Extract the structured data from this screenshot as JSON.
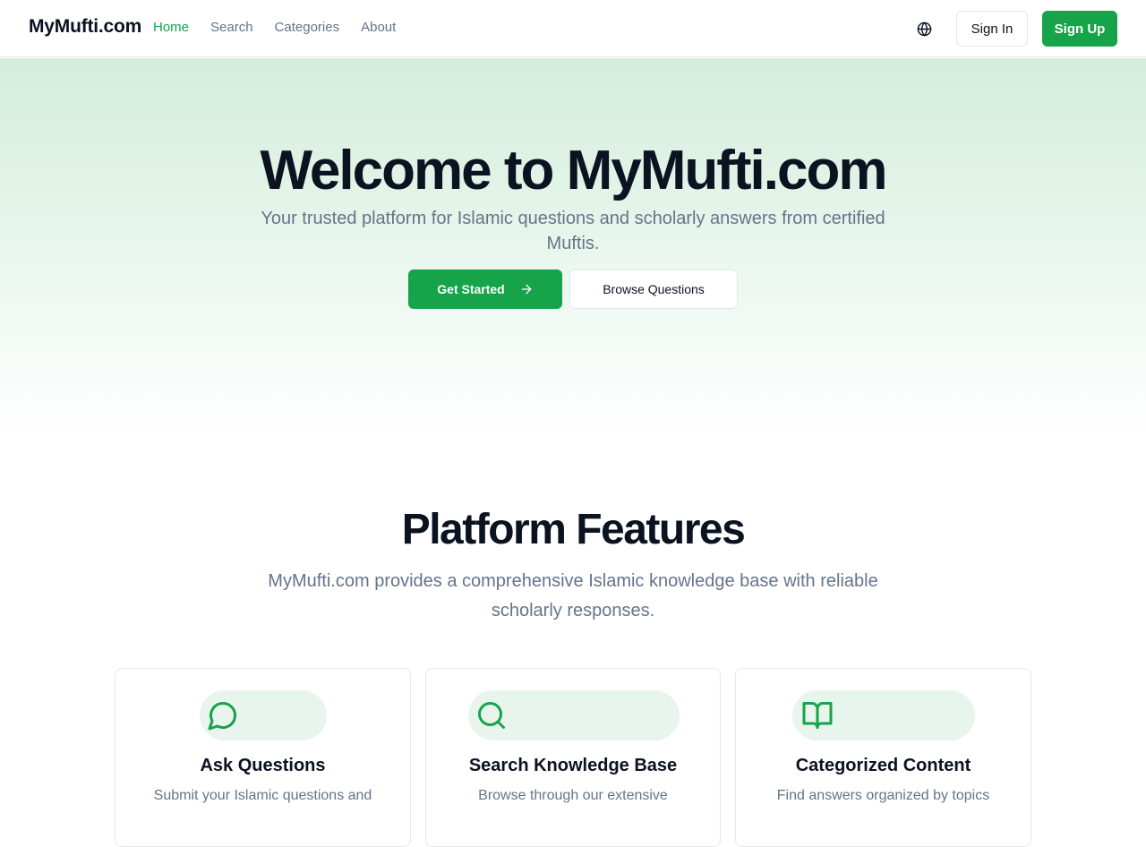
{
  "header": {
    "logo": "MyMufti.com",
    "nav": [
      {
        "label": "Home"
      },
      {
        "label": "Search"
      },
      {
        "label": "Categories"
      },
      {
        "label": "About"
      }
    ],
    "sign_in": "Sign In",
    "sign_up": "Sign Up"
  },
  "hero": {
    "title": "Welcome to MyMufti.com",
    "subtitle": "Your trusted platform for Islamic questions and scholarly answers from certified Muftis.",
    "get_started": "Get Started",
    "browse": "Browse Questions"
  },
  "features": {
    "title": "Platform Features",
    "subtitle": "MyMufti.com provides a comprehensive Islamic knowledge base with reliable scholarly responses.",
    "cards": [
      {
        "icon": "chat-bubble-icon",
        "title": "Ask Questions",
        "desc": "Submit your Islamic questions and"
      },
      {
        "icon": "search-icon",
        "title": "Search Knowledge Base",
        "desc": "Browse through our extensive"
      },
      {
        "icon": "book-open-icon",
        "title": "Categorized Content",
        "desc": "Find answers organized by topics"
      }
    ]
  },
  "colors": {
    "brand": "#16a34a",
    "text_primary": "#0b1220",
    "text_muted": "#64748b"
  }
}
